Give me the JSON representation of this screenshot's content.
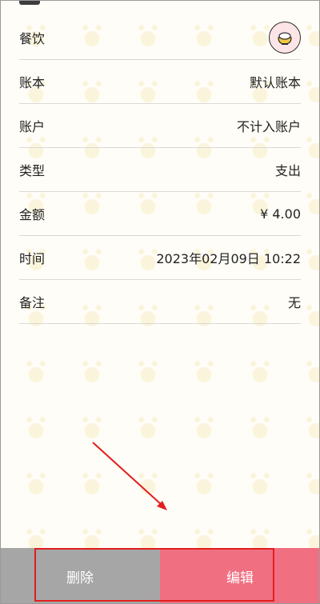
{
  "detail": {
    "rows": [
      {
        "label": "餐饮",
        "value": ""
      },
      {
        "label": "账本",
        "value": "默认账本"
      },
      {
        "label": "账户",
        "value": "不计入账户"
      },
      {
        "label": "类型",
        "value": "支出"
      },
      {
        "label": "金额",
        "value": "¥ 4.00"
      },
      {
        "label": "时间",
        "value": "2023年02月09日 10:22"
      },
      {
        "label": "备注",
        "value": "无"
      }
    ],
    "category_icon": "rice-bowl-icon"
  },
  "actions": {
    "delete_label": "删除",
    "edit_label": "编辑"
  },
  "colors": {
    "delete_bg": "#a6a6a6",
    "edit_bg": "#f06f81",
    "annotation": "#e21e1e"
  }
}
